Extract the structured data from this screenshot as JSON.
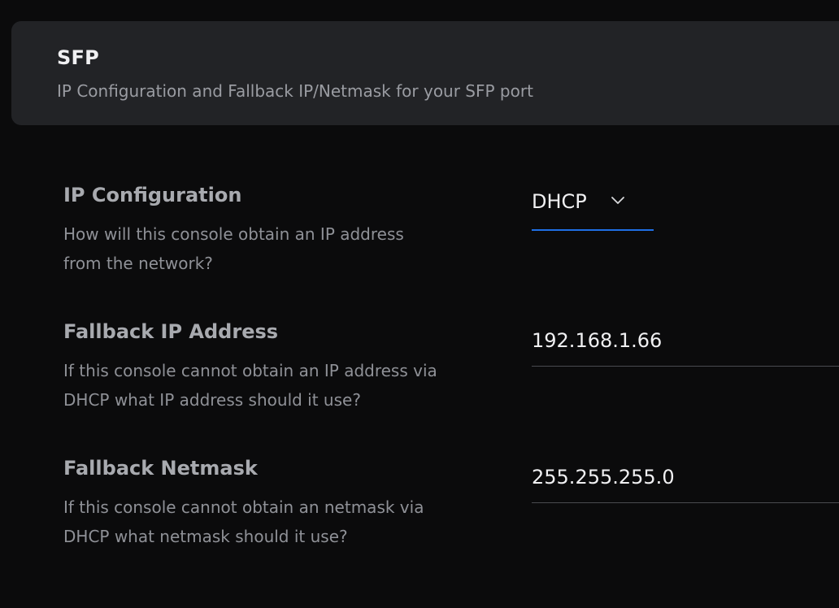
{
  "header": {
    "title": "SFP",
    "subtitle": "IP Configuration and Fallback IP/Netmask for your SFP port"
  },
  "ip_configuration": {
    "label": "IP Configuration",
    "description": "How will this console obtain an IP address from the network?",
    "selected": "DHCP",
    "icon": "chevron-down-icon",
    "accent_color": "#1f6fe5"
  },
  "fallback_ip": {
    "label": "Fallback IP Address",
    "description": "If this console cannot obtain an IP address via DHCP what IP address should it use?",
    "value": "192.168.1.66"
  },
  "fallback_netmask": {
    "label": "Fallback Netmask",
    "description": "If this console cannot obtain an netmask via DHCP what netmask should it use?",
    "value": "255.255.255.0"
  }
}
